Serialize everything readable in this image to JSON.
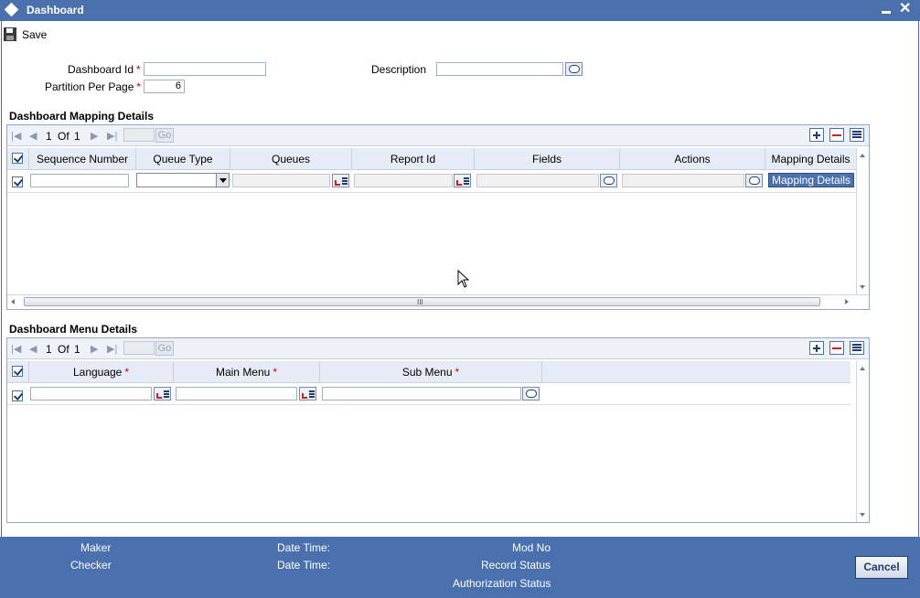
{
  "window": {
    "title": "Dashboard"
  },
  "toolbar": {
    "save_label": "Save"
  },
  "form": {
    "dashboard_id_label": "Dashboard Id",
    "dashboard_id_value": "",
    "partition_label": "Partition Per Page",
    "partition_value": "6",
    "description_label": "Description",
    "description_value": "",
    "required_mark": "*"
  },
  "mapping": {
    "title": "Dashboard Mapping Details",
    "pager": {
      "current": "1",
      "of_label": "Of",
      "total": "1",
      "go_label": "Go"
    },
    "columns": [
      "Sequence Number",
      "Queue Type",
      "Queues",
      "Report Id",
      "Fields",
      "Actions",
      "Mapping Details"
    ],
    "row": {
      "sequence_number": "",
      "queue_type": "",
      "queues": "",
      "report_id": "",
      "fields": "",
      "actions": "",
      "mapping_button_label": "Mapping Details"
    },
    "hscroll_grip": "III"
  },
  "menu": {
    "title": "Dashboard Menu Details",
    "pager": {
      "current": "1",
      "of_label": "Of",
      "total": "1",
      "go_label": "Go"
    },
    "columns": [
      "Language",
      "Main Menu",
      "Sub Menu"
    ],
    "row": {
      "language": "",
      "main_menu": "",
      "sub_menu": ""
    }
  },
  "footer": {
    "maker_label": "Maker",
    "checker_label": "Checker",
    "date_time_label_1": "Date Time:",
    "date_time_label_2": "Date Time:",
    "mod_no_label": "Mod No",
    "record_status_label": "Record Status",
    "auth_status_label": "Authorization Status",
    "cancel_label": "Cancel"
  },
  "colors": {
    "accent": "#4a71ad",
    "required": "#d00000",
    "header_bg": "#e6ecf5"
  },
  "icons": [
    "window-icon",
    "minimize-icon",
    "close-icon",
    "save-icon",
    "message-icon",
    "list-of-values-icon",
    "add-row-icon",
    "delete-row-icon",
    "single-view-icon",
    "first-page-icon",
    "previous-page-icon",
    "next-page-icon",
    "last-page-icon"
  ]
}
